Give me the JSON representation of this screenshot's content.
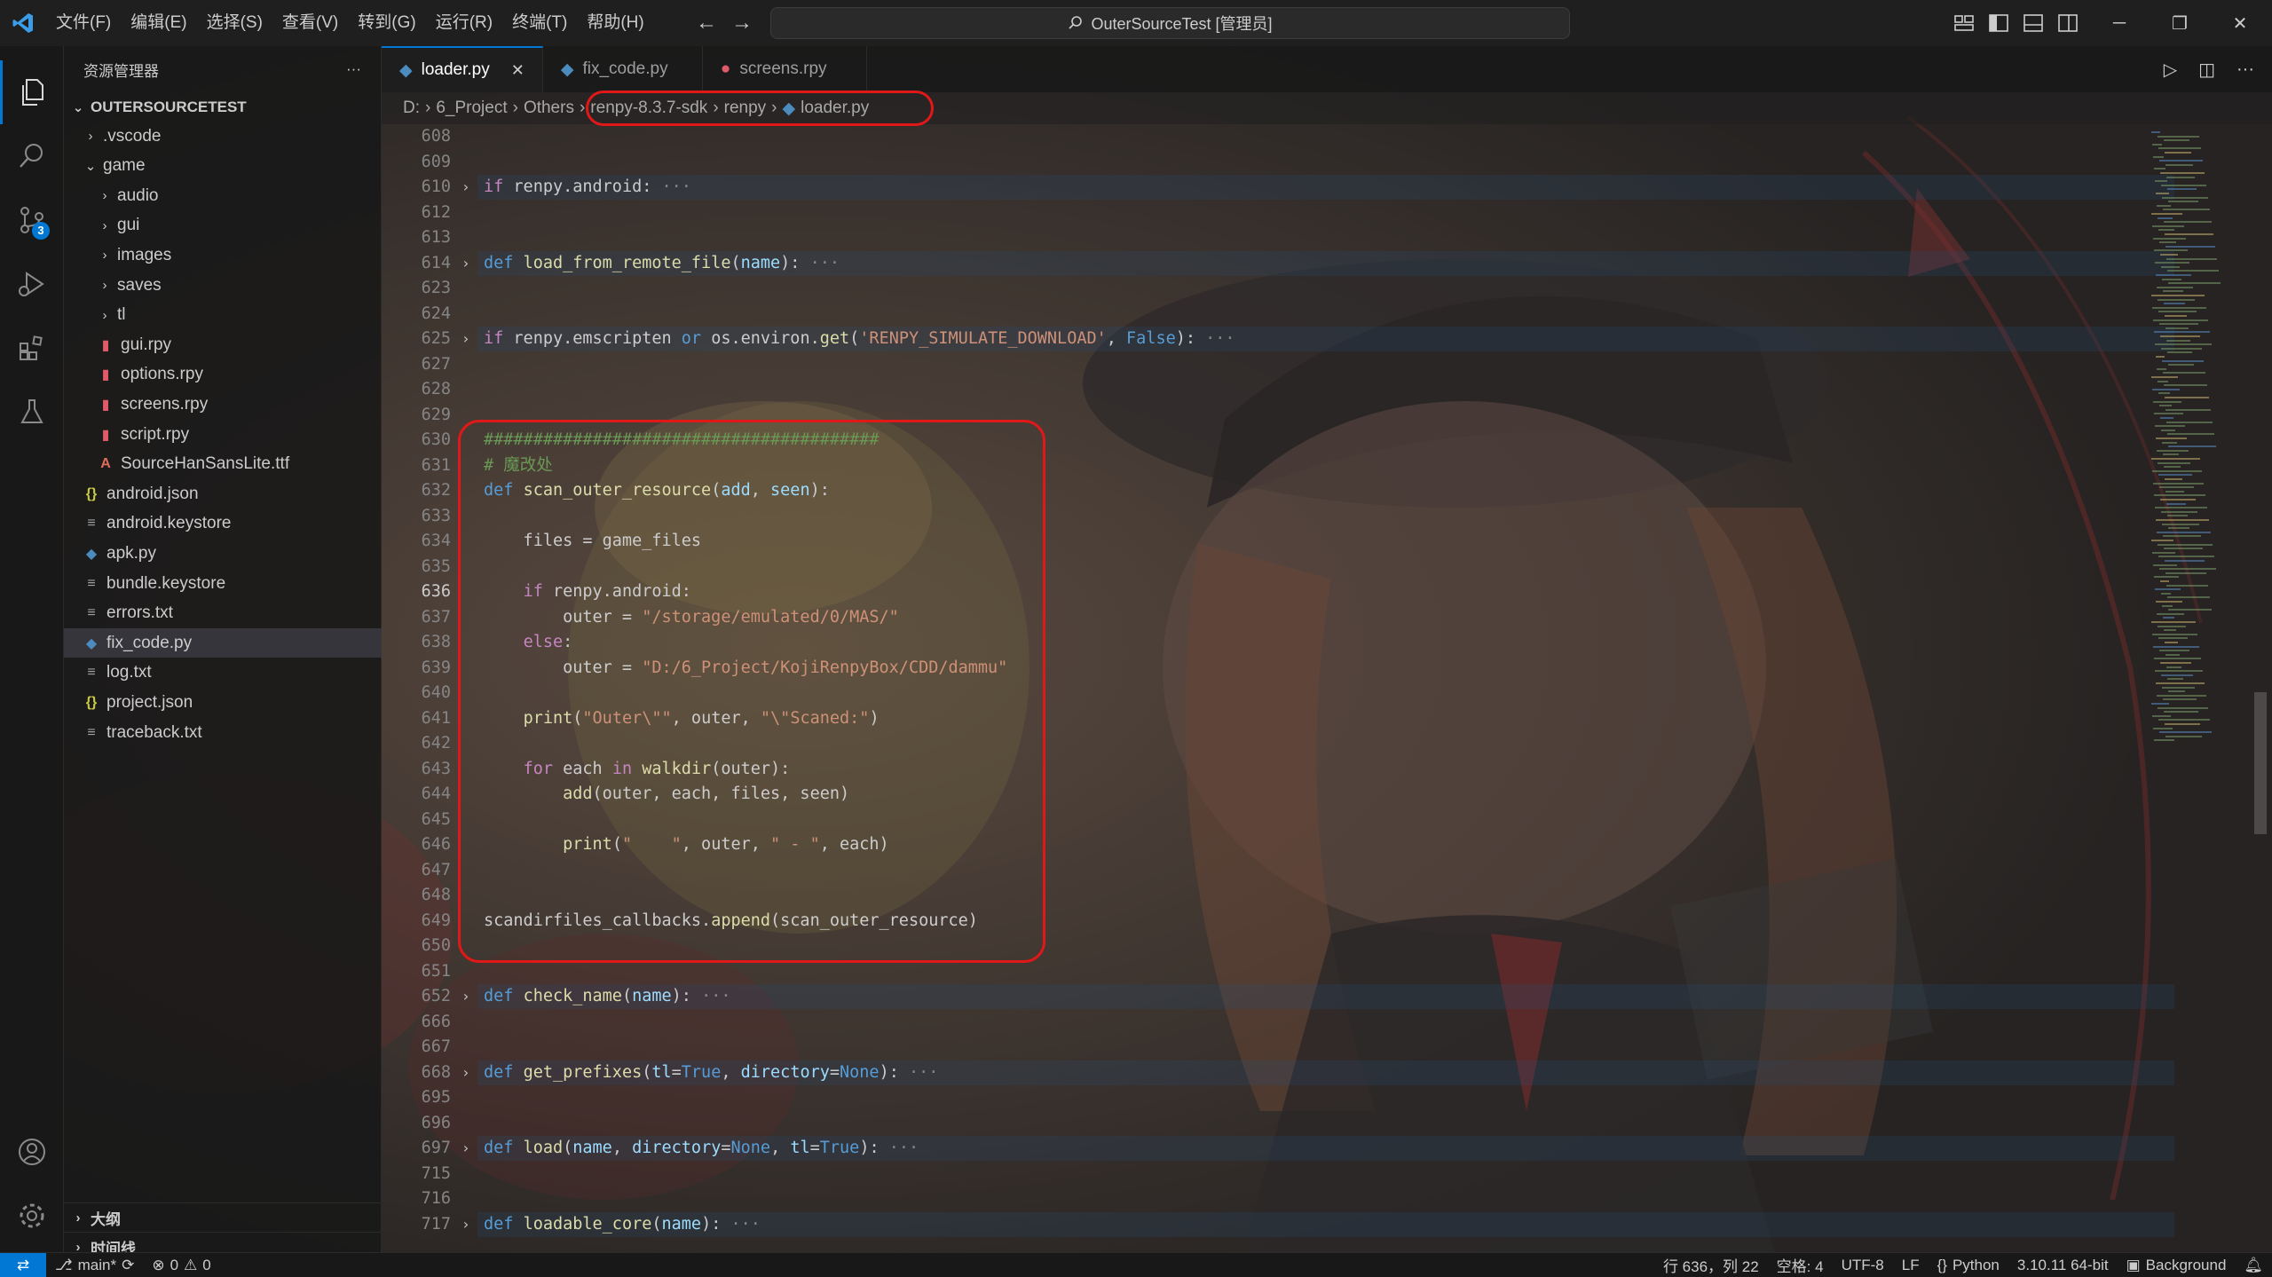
{
  "window": {
    "title": "OuterSourceTest [管理员]",
    "menu": [
      "文件(F)",
      "编辑(E)",
      "选择(S)",
      "查看(V)",
      "转到(G)",
      "运行(R)",
      "终端(T)",
      "帮助(H)"
    ]
  },
  "activity": {
    "source_control_badge": "3"
  },
  "sidebar": {
    "header": "资源管理器",
    "header_more": "···",
    "root": "OUTERSOURCETEST",
    "tree": [
      {
        "label": ".vscode",
        "type": "folder",
        "depth": 1,
        "open": false
      },
      {
        "label": "game",
        "type": "folder",
        "depth": 1,
        "open": true
      },
      {
        "label": "audio",
        "type": "folder",
        "depth": 2,
        "open": false
      },
      {
        "label": "gui",
        "type": "folder",
        "depth": 2,
        "open": false
      },
      {
        "label": "images",
        "type": "folder",
        "depth": 2,
        "open": false
      },
      {
        "label": "saves",
        "type": "folder",
        "depth": 2,
        "open": false
      },
      {
        "label": "tl",
        "type": "folder",
        "depth": 2,
        "open": false
      },
      {
        "label": "gui.rpy",
        "type": "rpy",
        "depth": 2
      },
      {
        "label": "options.rpy",
        "type": "rpy",
        "depth": 2
      },
      {
        "label": "screens.rpy",
        "type": "rpy",
        "depth": 2
      },
      {
        "label": "script.rpy",
        "type": "rpy",
        "depth": 2
      },
      {
        "label": "SourceHanSansLite.ttf",
        "type": "font",
        "depth": 2
      },
      {
        "label": "android.json",
        "type": "json",
        "depth": 1
      },
      {
        "label": "android.keystore",
        "type": "text",
        "depth": 1
      },
      {
        "label": "apk.py",
        "type": "py",
        "depth": 1
      },
      {
        "label": "bundle.keystore",
        "type": "text",
        "depth": 1
      },
      {
        "label": "errors.txt",
        "type": "text",
        "depth": 1
      },
      {
        "label": "fix_code.py",
        "type": "py",
        "depth": 1,
        "selected": true
      },
      {
        "label": "log.txt",
        "type": "text",
        "depth": 1
      },
      {
        "label": "project.json",
        "type": "json",
        "depth": 1
      },
      {
        "label": "traceback.txt",
        "type": "text",
        "depth": 1
      }
    ],
    "outline": "大纲",
    "timeline": "时间线"
  },
  "tabs": [
    {
      "label": "loader.py",
      "icon": "python-icon",
      "active": true
    },
    {
      "label": "fix_code.py",
      "icon": "python-icon",
      "active": false
    },
    {
      "label": "screens.rpy",
      "icon": "renpy-icon",
      "active": false
    }
  ],
  "breadcrumb": [
    "D:",
    "6_Project",
    "Others",
    "renpy-8.3.7-sdk",
    "renpy",
    "loader.py"
  ],
  "colors": {
    "accent": "#0078d4",
    "callout": "#e01818",
    "keyword": "#569cd6",
    "control": "#c586c0",
    "function": "#dcdcaa",
    "string": "#ce9178",
    "comment": "#6a9955",
    "param": "#9cdcfe"
  },
  "code": {
    "cursor_line": "636",
    "lines": [
      {
        "n": "608",
        "fold": false,
        "tokens": []
      },
      {
        "n": "609",
        "fold": false,
        "tokens": []
      },
      {
        "n": "610",
        "fold": true,
        "tokens": [
          [
            "kw2",
            "if "
          ],
          [
            "t",
            "renpy.android:"
          ],
          [
            "e",
            " ···"
          ]
        ]
      },
      {
        "n": "612",
        "fold": false,
        "tokens": []
      },
      {
        "n": "613",
        "fold": false,
        "tokens": []
      },
      {
        "n": "614",
        "fold": true,
        "tokens": [
          [
            "kw",
            "def "
          ],
          [
            "fn",
            "load_from_remote_file"
          ],
          [
            "t",
            "("
          ],
          [
            "pm",
            "name"
          ],
          [
            "t",
            "):"
          ],
          [
            "e",
            " ···"
          ]
        ]
      },
      {
        "n": "623",
        "fold": false,
        "tokens": []
      },
      {
        "n": "624",
        "fold": false,
        "tokens": []
      },
      {
        "n": "625",
        "fold": true,
        "tokens": [
          [
            "kw2",
            "if "
          ],
          [
            "t",
            "renpy.emscripten "
          ],
          [
            "kw",
            "or "
          ],
          [
            "t",
            "os.environ."
          ],
          [
            "fn",
            "get"
          ],
          [
            "t",
            "("
          ],
          [
            "st",
            "'RENPY_SIMULATE_DOWNLOAD'"
          ],
          [
            "t",
            ", "
          ],
          [
            "kw",
            "False"
          ],
          [
            "t",
            "):"
          ],
          [
            "e",
            " ···"
          ]
        ]
      },
      {
        "n": "627",
        "fold": false,
        "tokens": []
      },
      {
        "n": "628",
        "fold": false,
        "tokens": []
      },
      {
        "n": "629",
        "fold": false,
        "tokens": []
      },
      {
        "n": "630",
        "fold": false,
        "tokens": [
          [
            "cm",
            "########################################"
          ]
        ]
      },
      {
        "n": "631",
        "fold": false,
        "tokens": [
          [
            "cm",
            "# 魔改处"
          ]
        ]
      },
      {
        "n": "632",
        "fold": false,
        "tokens": [
          [
            "kw",
            "def "
          ],
          [
            "fn",
            "scan_outer_resource"
          ],
          [
            "t",
            "("
          ],
          [
            "pm",
            "add"
          ],
          [
            "t",
            ", "
          ],
          [
            "pm",
            "seen"
          ],
          [
            "t",
            "):"
          ]
        ]
      },
      {
        "n": "633",
        "fold": false,
        "tokens": []
      },
      {
        "n": "634",
        "fold": false,
        "tokens": [
          [
            "t",
            "    files = game_files"
          ]
        ]
      },
      {
        "n": "635",
        "fold": false,
        "tokens": []
      },
      {
        "n": "636",
        "fold": false,
        "tokens": [
          [
            "t",
            "    "
          ],
          [
            "kw2",
            "if "
          ],
          [
            "t",
            "renpy.android:"
          ]
        ]
      },
      {
        "n": "637",
        "fold": false,
        "tokens": [
          [
            "t",
            "        outer = "
          ],
          [
            "st",
            "\"/storage/emulated/0/MAS/\""
          ]
        ]
      },
      {
        "n": "638",
        "fold": false,
        "tokens": [
          [
            "t",
            "    "
          ],
          [
            "kw2",
            "else"
          ],
          [
            "t",
            ":"
          ]
        ]
      },
      {
        "n": "639",
        "fold": false,
        "tokens": [
          [
            "t",
            "        outer = "
          ],
          [
            "st",
            "\"D:/6_Project/KojiRenpyBox/CDD/dammu\""
          ]
        ]
      },
      {
        "n": "640",
        "fold": false,
        "tokens": []
      },
      {
        "n": "641",
        "fold": false,
        "tokens": [
          [
            "t",
            "    "
          ],
          [
            "fn",
            "print"
          ],
          [
            "t",
            "("
          ],
          [
            "st",
            "\"Outer\\\"\""
          ],
          [
            "t",
            ", outer, "
          ],
          [
            "st",
            "\"\\\"Scaned:\""
          ],
          [
            "t",
            ")"
          ]
        ]
      },
      {
        "n": "642",
        "fold": false,
        "tokens": []
      },
      {
        "n": "643",
        "fold": false,
        "tokens": [
          [
            "t",
            "    "
          ],
          [
            "kw2",
            "for "
          ],
          [
            "t",
            "each "
          ],
          [
            "kw2",
            "in "
          ],
          [
            "fn",
            "walkdir"
          ],
          [
            "t",
            "(outer):"
          ]
        ]
      },
      {
        "n": "644",
        "fold": false,
        "tokens": [
          [
            "t",
            "        "
          ],
          [
            "fn",
            "add"
          ],
          [
            "t",
            "(outer, each, files, seen)"
          ]
        ]
      },
      {
        "n": "645",
        "fold": false,
        "tokens": []
      },
      {
        "n": "646",
        "fold": false,
        "tokens": [
          [
            "t",
            "        "
          ],
          [
            "fn",
            "print"
          ],
          [
            "t",
            "("
          ],
          [
            "st",
            "\"    \""
          ],
          [
            "t",
            ", outer, "
          ],
          [
            "st",
            "\" - \""
          ],
          [
            "t",
            ", each)"
          ]
        ]
      },
      {
        "n": "647",
        "fold": false,
        "tokens": []
      },
      {
        "n": "648",
        "fold": false,
        "tokens": []
      },
      {
        "n": "649",
        "fold": false,
        "tokens": [
          [
            "t",
            "scandirfiles_callbacks."
          ],
          [
            "fn",
            "append"
          ],
          [
            "t",
            "(scan_outer_resource)"
          ]
        ]
      },
      {
        "n": "650",
        "fold": false,
        "tokens": []
      },
      {
        "n": "651",
        "fold": false,
        "tokens": []
      },
      {
        "n": "652",
        "fold": true,
        "tokens": [
          [
            "kw",
            "def "
          ],
          [
            "fn",
            "check_name"
          ],
          [
            "t",
            "("
          ],
          [
            "pm",
            "name"
          ],
          [
            "t",
            "):"
          ],
          [
            "e",
            " ···"
          ]
        ]
      },
      {
        "n": "666",
        "fold": false,
        "tokens": []
      },
      {
        "n": "667",
        "fold": false,
        "tokens": []
      },
      {
        "n": "668",
        "fold": true,
        "tokens": [
          [
            "kw",
            "def "
          ],
          [
            "fn",
            "get_prefixes"
          ],
          [
            "t",
            "("
          ],
          [
            "pm",
            "tl"
          ],
          [
            "t",
            "="
          ],
          [
            "kw",
            "True"
          ],
          [
            "t",
            ", "
          ],
          [
            "pm",
            "directory"
          ],
          [
            "t",
            "="
          ],
          [
            "kw",
            "None"
          ],
          [
            "t",
            "):"
          ],
          [
            "e",
            " ···"
          ]
        ]
      },
      {
        "n": "695",
        "fold": false,
        "tokens": []
      },
      {
        "n": "696",
        "fold": false,
        "tokens": []
      },
      {
        "n": "697",
        "fold": true,
        "tokens": [
          [
            "kw",
            "def "
          ],
          [
            "fn",
            "load"
          ],
          [
            "t",
            "("
          ],
          [
            "pm",
            "name"
          ],
          [
            "t",
            ", "
          ],
          [
            "pm",
            "directory"
          ],
          [
            "t",
            "="
          ],
          [
            "kw",
            "None"
          ],
          [
            "t",
            ", "
          ],
          [
            "pm",
            "tl"
          ],
          [
            "t",
            "="
          ],
          [
            "kw",
            "True"
          ],
          [
            "t",
            "):"
          ],
          [
            "e",
            " ···"
          ]
        ]
      },
      {
        "n": "715",
        "fold": false,
        "tokens": []
      },
      {
        "n": "716",
        "fold": false,
        "tokens": []
      },
      {
        "n": "717",
        "fold": true,
        "tokens": [
          [
            "kw",
            "def "
          ],
          [
            "fn",
            "loadable_core"
          ],
          [
            "t",
            "("
          ],
          [
            "pm",
            "name"
          ],
          [
            "t",
            "):"
          ],
          [
            "e",
            " ···"
          ]
        ]
      }
    ]
  },
  "status": {
    "branch": "main*",
    "errors": "0",
    "warnings": "0",
    "position": "行 636，列 22",
    "spaces": "空格: 4",
    "encoding": "UTF-8",
    "eol": "LF",
    "language": "Python",
    "interpreter": "3.10.11 64-bit",
    "background": "Background"
  }
}
